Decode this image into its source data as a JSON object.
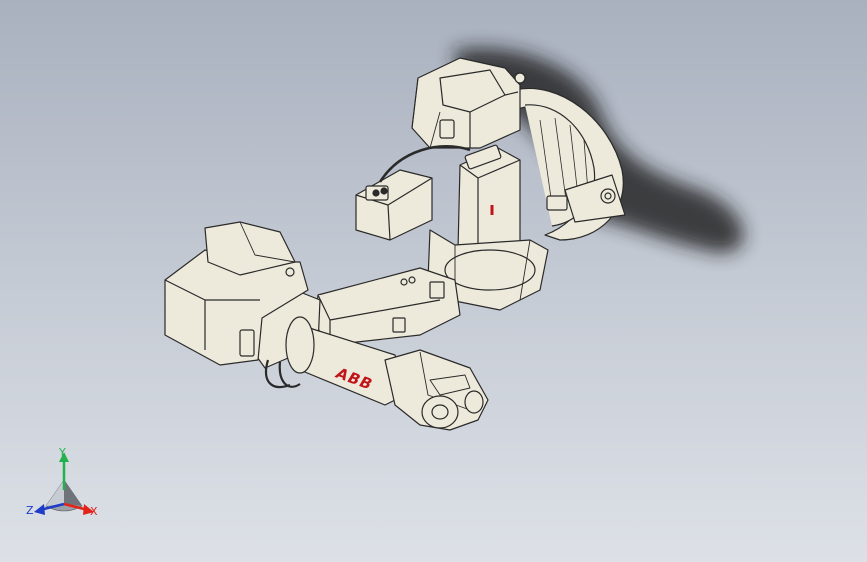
{
  "viewport": {
    "background_top": "#a9b1bf",
    "background_bottom": "#dde1e7"
  },
  "model": {
    "logo": "ABB",
    "logo_color": "#c0141a",
    "body_color": "#eeeadb",
    "edge_color": "#2a2a2a",
    "shadow_color": "#1a1a1a"
  },
  "triad": {
    "y_label": "Y",
    "x_label": "X",
    "z_label": "Z",
    "y_color": "#22b14c",
    "x_color": "#e2231a",
    "z_color": "#1e3cc8"
  }
}
